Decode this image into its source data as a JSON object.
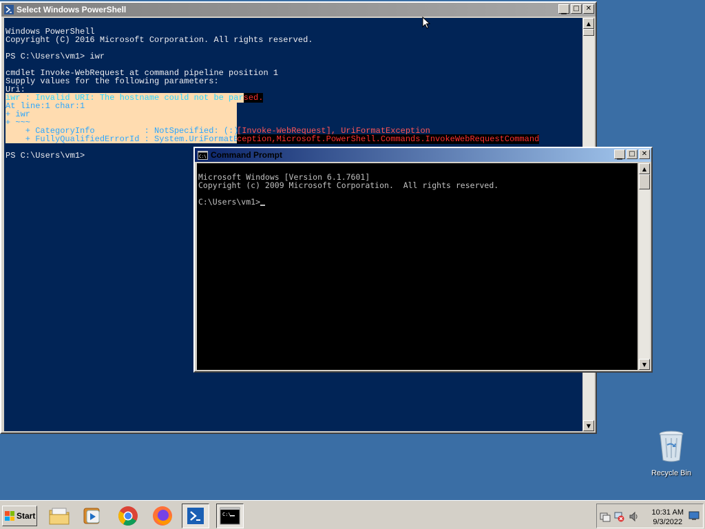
{
  "desktop": {
    "background_color": "#3a6ea5",
    "icons": [
      {
        "label": "Recycle Bin",
        "icon": "recycle-bin-icon"
      }
    ]
  },
  "powershell": {
    "title": "Select Windows PowerShell",
    "buttons": {
      "minimize": "_",
      "maximize": "□",
      "close": "×"
    },
    "lines": {
      "l1": "Windows PowerShell",
      "l2": "Copyright (C) 2016 Microsoft Corporation. All rights reserved.",
      "l3": "",
      "l4": "PS C:\\Users\\vm1> iwr",
      "l5": "",
      "l6": "cmdlet Invoke-WebRequest at command pipeline position 1",
      "l7": "Supply values for the following parameters:",
      "l8": "Uri:",
      "e1a": "iwr : Invalid URI: The hostname could not be par",
      "e1b": "sed.",
      "e2": "At line:1 char:1",
      "e3": "+ iwr",
      "e4": "+ ~~~",
      "e5a": "    + CategoryInfo          : NotSpecified: (:) ",
      "e5b": "[Invoke-WebRequest], UriFormatException",
      "e6a": "    + FullyQualifiedErrorId : System.UriFormatEx",
      "e6b": "ception,Microsoft.PowerShell.Commands.InvokeWebRequestCommand",
      "l9": "",
      "l10": "PS C:\\Users\\vm1>"
    },
    "colors": {
      "background": "#012456",
      "text": "#eeedf0",
      "error": "#ff3030"
    }
  },
  "cmd": {
    "title": "Command Prompt",
    "lines": {
      "l1": "Microsoft Windows [Version 6.1.7601]",
      "l2": "Copyright (c) 2009 Microsoft Corporation.  All rights reserved.",
      "l3": "",
      "l4": "C:\\Users\\vm1>"
    },
    "colors": {
      "background": "#000000",
      "text": "#c0c0c0"
    }
  },
  "taskbar": {
    "start_label": "Start",
    "pinned": [
      {
        "name": "explorer",
        "icon": "folder-icon"
      },
      {
        "name": "media-player",
        "icon": "media-player-icon"
      },
      {
        "name": "chrome",
        "icon": "chrome-icon"
      },
      {
        "name": "firefox",
        "icon": "firefox-icon"
      },
      {
        "name": "powershell",
        "icon": "powershell-icon"
      },
      {
        "name": "cmd",
        "icon": "cmd-icon"
      }
    ],
    "clock_time": "10:31 AM",
    "clock_date": "9/3/2022"
  }
}
